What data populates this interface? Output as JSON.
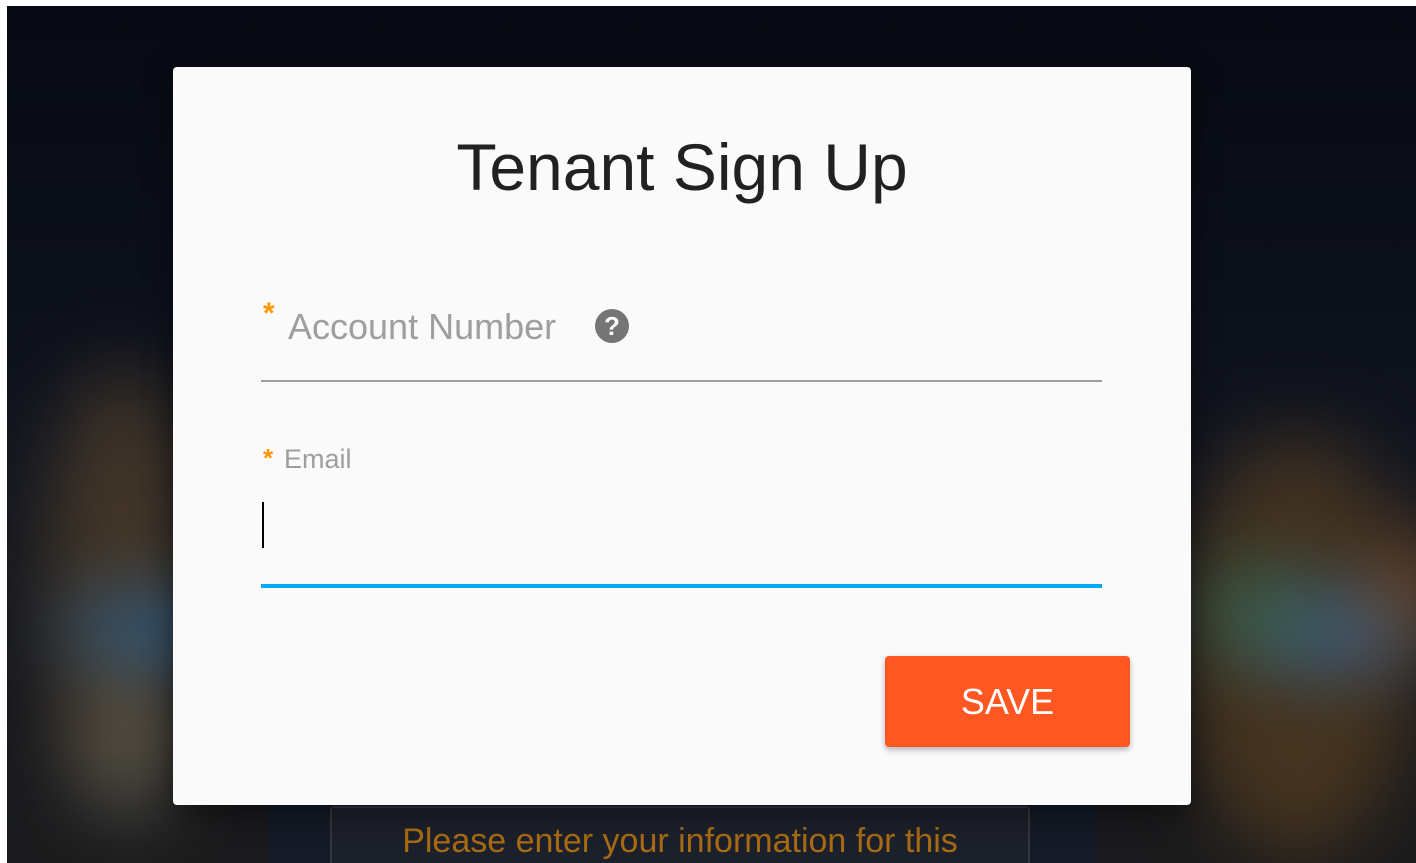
{
  "modal": {
    "title": "Tenant Sign Up",
    "fields": [
      {
        "label": "Account Number",
        "required_marker": "*",
        "value": "",
        "placeholder": "",
        "help_icon": "question-circle-icon",
        "help_glyph": "?"
      },
      {
        "label": "Email",
        "required_marker": "*",
        "value": "",
        "placeholder": "",
        "focused": true
      }
    ],
    "save_label": "SAVE"
  },
  "background": {
    "message": "Please enter your information for this"
  },
  "colors": {
    "required": "#ff9800",
    "focus_underline": "#03a9f4",
    "primary_button": "#ff5722",
    "underlay_text": "#a86a12",
    "modal_bg": "#fafafa"
  }
}
